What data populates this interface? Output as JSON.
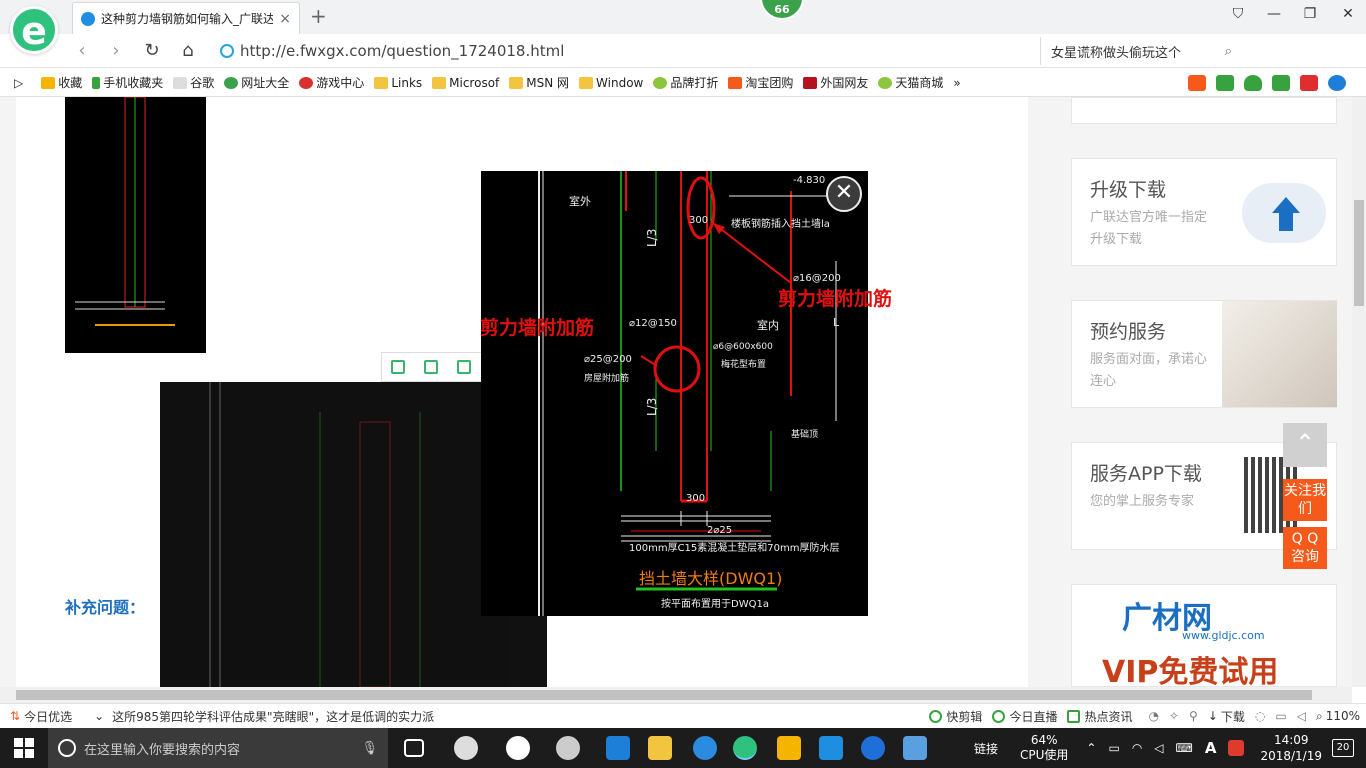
{
  "tab": {
    "title": "这种剪力墙钢筋如何输入_广联达",
    "close": "×"
  },
  "newtab": "+",
  "badge": "66",
  "window": {
    "tshirt": "⛉",
    "minimize": "—",
    "restore": "❐",
    "close": "✕"
  },
  "nav": {
    "back": "‹",
    "forward": "›",
    "reload": "↻",
    "home": "⌂"
  },
  "address": {
    "url": "http://e.fwxgx.com/question_1724018.html"
  },
  "search": {
    "placeholder": "女星谎称做头偷玩这个",
    "icon": "⌕"
  },
  "bookmarks": [
    "收藏",
    "手机收藏夹",
    "谷歌",
    "网址大全",
    "游戏中心",
    "Links",
    "Microsof",
    "MSN 网",
    "Window",
    "品牌打折",
    "淘宝团购",
    "外国网友",
    "天猫商城"
  ],
  "bm_more": "»",
  "page": {
    "supplement_label": "补充问题：",
    "overlay_labels": {
      "left": "剪力墙附加筋",
      "right": "剪力墙附加筋"
    },
    "cad": {
      "t1": "-4.830",
      "t2": "室外",
      "t3": "300",
      "t4": "楼板钢筋插入挡土墙la",
      "t5": "L/3",
      "t6": "⌀16@200",
      "t7": "⌀12@150",
      "t8": "室内",
      "t9": "⌀25@200",
      "t10": "⌀6@600x600",
      "t11": "房屋附加筋",
      "t12": "梅花型布置",
      "t13": "L/3",
      "t14": "基础顶",
      "t15": "300",
      "t16": "2⌀25",
      "t17": "100mm厚C15素混凝土垫层和70mm厚防水层",
      "t18": "挡土墙大样(DWQ1)",
      "t19": "按平面布置用于DWQ1a",
      "t20": "L"
    },
    "close_button": "✕"
  },
  "sidebar": {
    "cards": [
      {
        "title": "升级下载",
        "desc": "广联达官方唯一指定升级下载"
      },
      {
        "title": "预约服务",
        "desc": "服务面对面，承诺心连心"
      },
      {
        "title": "服务APP下载",
        "desc": "您的掌上服务专家"
      },
      {
        "title": "广材网",
        "desc": "www.gldjc.com"
      }
    ],
    "vip": "VIP免费试用",
    "float_follow": "关注我们",
    "float_qq": "Q Q 咨询"
  },
  "status": {
    "today": "今日优选",
    "news": "这所985第四轮学科评估成果\"亮瞎眼\"，这才是低调的实力派",
    "kuaijianji": "快剪辑",
    "live": "今日直播",
    "hot": "热点资讯",
    "download": "下载",
    "zoom": "110%"
  },
  "taskbar": {
    "search_placeholder": "在这里输入你要搜索的内容",
    "link": "链接",
    "cpu_pct": "64%",
    "cpu_label": "CPU使用",
    "time": "14:09",
    "date": "2018/1/19",
    "notif": "20",
    "ime": "A"
  },
  "colors": {
    "accent_green": "#2ec27e",
    "red": "#e01010",
    "orange": "#f55a1a",
    "link_blue": "#1f6fbf"
  }
}
